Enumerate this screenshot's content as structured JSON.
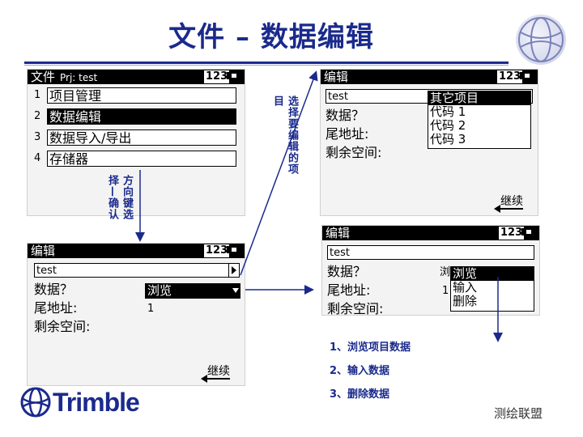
{
  "page": {
    "title": "文件 – 数据编辑",
    "brand": "Trimble",
    "watermark": "测绘联盟"
  },
  "screen1": {
    "header_title": "文件",
    "header_sub": "Prj: test",
    "badge": "123",
    "menu": [
      {
        "num": "1",
        "label": "项目管理",
        "selected": false
      },
      {
        "num": "2",
        "label": "数据编辑",
        "selected": true
      },
      {
        "num": "3",
        "label": "数据导入/导出",
        "selected": false
      },
      {
        "num": "4",
        "label": "存储器",
        "selected": false
      }
    ]
  },
  "screen2": {
    "header_title": "编辑",
    "badge": "123",
    "job_field": "test",
    "data_label": "数据？",
    "data_value": "浏览",
    "tail_label": "尾地址:",
    "tail_value": "1",
    "free_label": "剩余空间:",
    "continue_label": "继续"
  },
  "screen3": {
    "header_title": "编辑",
    "badge": "123",
    "job_field": "test",
    "data_label": "数据？",
    "tail_label": "尾地址:",
    "free_label": "剩余空间:",
    "popup": [
      "其它项目",
      "代码 1",
      "代码 2",
      "代码 3"
    ],
    "continue_label": "继续"
  },
  "screen4": {
    "header_title": "编辑",
    "badge": "123",
    "job_field": "test",
    "data_label": "数据？",
    "data_clip": "浏",
    "tail_label": "尾地址:",
    "tail_clip": "1",
    "free_label": "剩余空间:",
    "popup": [
      "浏览",
      "输入",
      "删除"
    ]
  },
  "annotations": {
    "col_a": "方向键选",
    "col_b": "择—确认",
    "col_c": "选择要编辑的项",
    "col_d": "目"
  },
  "notes": [
    "1、浏览项目数据",
    "2、输入数据",
    "3、删除数据"
  ],
  "colors": {
    "title": "#1a2a8c",
    "screen_bg": "#f3f3f3"
  }
}
